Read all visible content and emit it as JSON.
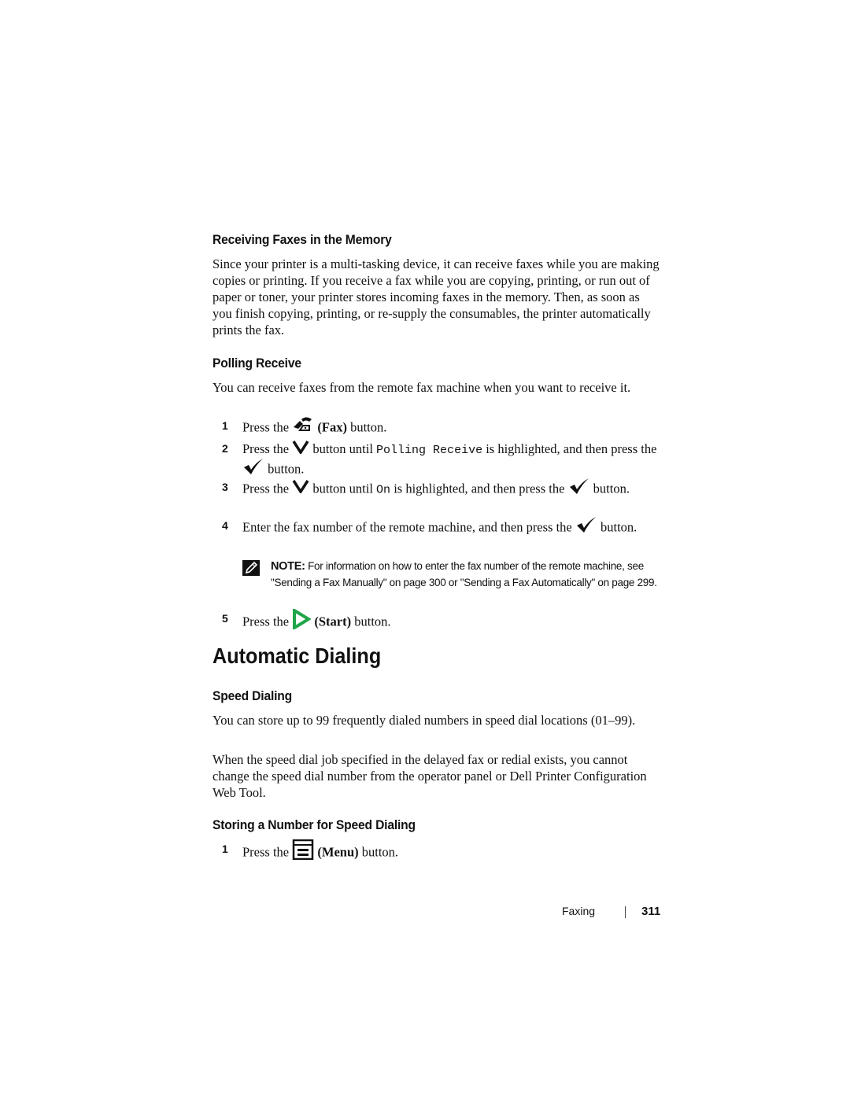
{
  "sections": {
    "receiving_memory": {
      "heading": "Receiving Faxes in the Memory",
      "body": "Since your printer is a multi-tasking device, it can receive faxes while you are making copies or printing. If you receive a fax while you are copying, printing, or run out of paper or toner, your printer stores incoming faxes in the memory. Then, as soon as you finish copying, printing, or re-supply the consumables, the printer automatically prints the fax."
    },
    "polling_receive": {
      "heading": "Polling Receive",
      "body": "You can receive faxes from the remote fax machine when you want to receive it.",
      "steps": [
        {
          "num": "1",
          "pre": "Press the",
          "icon": "fax-icon",
          "label": "(Fax)",
          "post": "button."
        },
        {
          "num": "2",
          "pre": "Press the",
          "icon": "down-arrow-icon",
          "mid1": "button until",
          "code": "Polling Receive",
          "mid2": "is highlighted, and then press the",
          "icon2": "check-icon",
          "post": "button."
        },
        {
          "num": "3",
          "pre": "Press the",
          "icon": "down-arrow-icon",
          "mid1": "button until",
          "code": "On",
          "mid2": "is highlighted, and then press the",
          "icon2": "check-icon",
          "post": "button."
        },
        {
          "num": "4",
          "pre": "Enter the fax number of the remote machine, and then press the",
          "icon": "check-icon",
          "post": "button."
        },
        {
          "num": "5",
          "pre": "Press the",
          "icon": "start-icon",
          "label": "(Start)",
          "post": "button."
        }
      ],
      "note": {
        "label": "NOTE:",
        "text": "For information on how to enter the fax number of the remote machine, see \"Sending a Fax Manually\" on page 300 or \"Sending a Fax Automatically\" on page 299."
      }
    },
    "automatic_dialing": {
      "heading": "Automatic Dialing"
    },
    "speed_dialing": {
      "heading": "Speed Dialing",
      "body1": "You can store up to 99 frequently dialed numbers in speed dial locations (01–99).",
      "body2": "When the speed dial job specified in the delayed fax or redial exists, you cannot change the speed dial number from the operator panel or Dell Printer Configuration Web Tool."
    },
    "storing_number": {
      "heading": "Storing a Number for Speed Dialing",
      "steps": [
        {
          "num": "1",
          "pre": "Press the",
          "icon": "menu-icon",
          "label": "(Menu)",
          "post": "button."
        }
      ]
    }
  },
  "footer": {
    "section": "Faxing",
    "page_number": "311"
  },
  "colors": {
    "start_icon": "#1fa64a",
    "text": "#111111"
  }
}
